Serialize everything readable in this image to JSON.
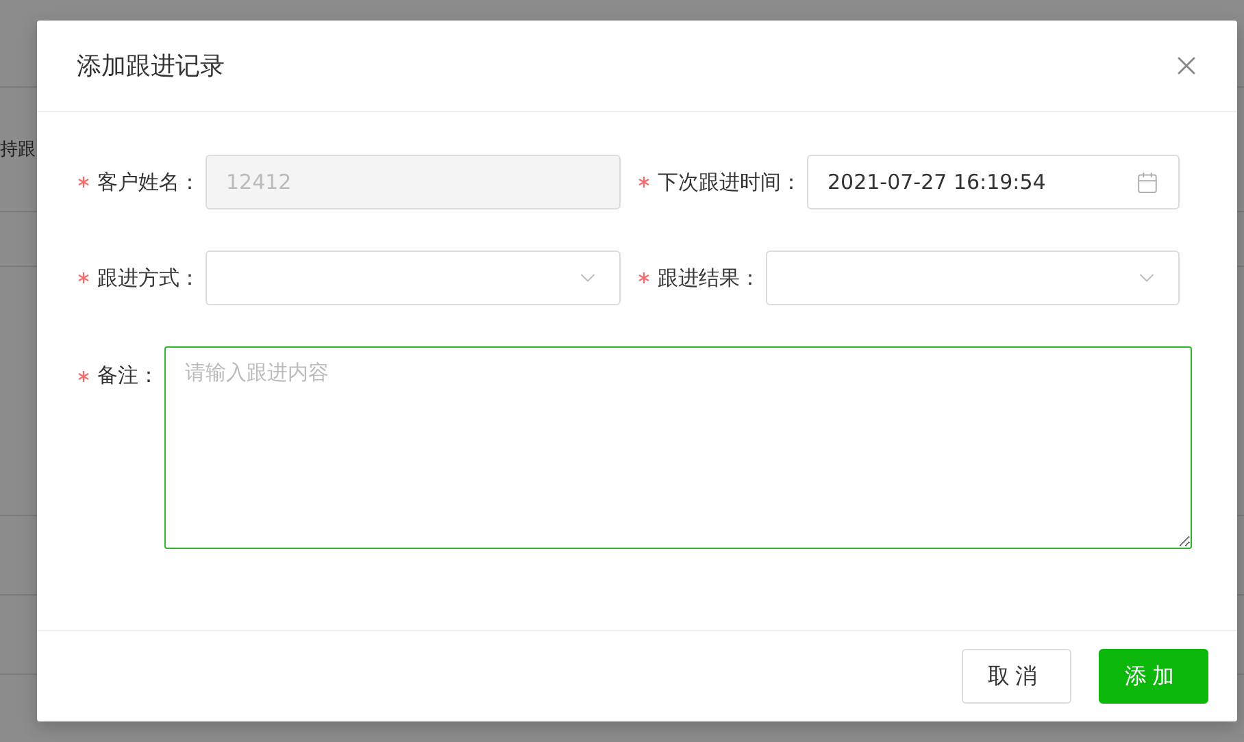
{
  "background": {
    "cell_text": "持跟"
  },
  "dialog": {
    "title": "添加跟进记录",
    "rows": [
      [
        {
          "label": "客户姓名：",
          "required": true,
          "kind": "text",
          "value": "12412",
          "disabled": true
        },
        {
          "label": "下次跟进时间：",
          "required": true,
          "kind": "date",
          "value": "2021-07-27 16:19:54",
          "disabled": false
        }
      ],
      [
        {
          "label": "跟进方式：",
          "required": true,
          "kind": "select",
          "disabled": false
        },
        {
          "label": "跟进结果：",
          "required": true,
          "kind": "select",
          "disabled": false
        }
      ]
    ],
    "remark": {
      "label": "备注：",
      "required": true,
      "placeholder": "请输入跟进内容",
      "focused": true
    },
    "buttons": [
      {
        "label": "取消",
        "kind": "default"
      },
      {
        "label": "添加",
        "kind": "primary"
      }
    ]
  }
}
